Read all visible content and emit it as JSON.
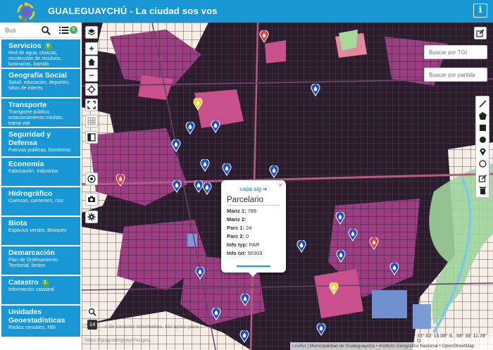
{
  "header": {
    "title": "GUALEGUAYCHÚ - La ciudad sos vos",
    "info_label": "i"
  },
  "sidebar": {
    "search": {
      "placeholder": "Bus"
    },
    "list_badge": "5",
    "categories": [
      {
        "title": "Servicios",
        "badge": "5",
        "desc": "Red de agua, cloacas, recolección de residuos, luminarias, barrido"
      },
      {
        "title": "Geografía Social",
        "badge": "",
        "desc": "Salud, educación, deportes, sitios de interés"
      },
      {
        "title": "Transporte",
        "badge": "",
        "desc": "Transporte público, estacionamiento medido, trama vial"
      },
      {
        "title": "Seguridad y Defensa",
        "badge": "",
        "desc": "Fuerzas publicas, bomberos"
      },
      {
        "title": "Economía",
        "badge": "",
        "desc": "Fabricación, Industrias"
      },
      {
        "title": "Hidrográfico",
        "badge": "",
        "desc": "Cuencas, corrientes, ríos"
      },
      {
        "title": "Biota",
        "badge": "",
        "desc": "Espacios verdes, Bosques"
      },
      {
        "title": "Demarcación",
        "badge": "",
        "desc": "Plan de Ordenamiento Territorial, limites"
      },
      {
        "title": "Catastro",
        "badge": "1",
        "desc": "Información catastral"
      },
      {
        "title": "Unidades Geoestadísticas",
        "badge": "",
        "desc": "Radios censales, NBI"
      }
    ]
  },
  "right_panel": {
    "tgi_placeholder": "Buscar por TGI",
    "partida_placeholder": "Buscar por partida"
  },
  "popup": {
    "close": "×",
    "next_layer": "capa sig.➔",
    "title": "Parcelario",
    "rows": [
      {
        "label": "Manz 1:",
        "value": "788"
      },
      {
        "label": "Manz 2:",
        "value": ""
      },
      {
        "label": "Parc 1:",
        "value": "24"
      },
      {
        "label": "Parc 2:",
        "value": "0"
      },
      {
        "label": "Info typ:",
        "value": "PAR"
      },
      {
        "label": "Info txt:",
        "value": "50303"
      }
    ]
  },
  "map": {
    "zoom_level": "14",
    "disclaimer": "...s de carácter informativo. No aptos para...",
    "url": "https://gisgualeguaychu.gov...",
    "coords": "33° 02' 15.08\" S , 58° 33' 11.78\" O",
    "attribution_leaflet": "Leaflet",
    "attribution_rest": " | Municipalidad de Gualeguaychú • Instituto Geográfico Nacional • OpenStreetMap"
  },
  "colors": {
    "header_blue": "#1996d4",
    "parcel_magenta": "#9c3f82",
    "parcel_pink": "#c8508c",
    "dark_parcel": "#2a1d2c",
    "badge_green": "#4caf50"
  }
}
